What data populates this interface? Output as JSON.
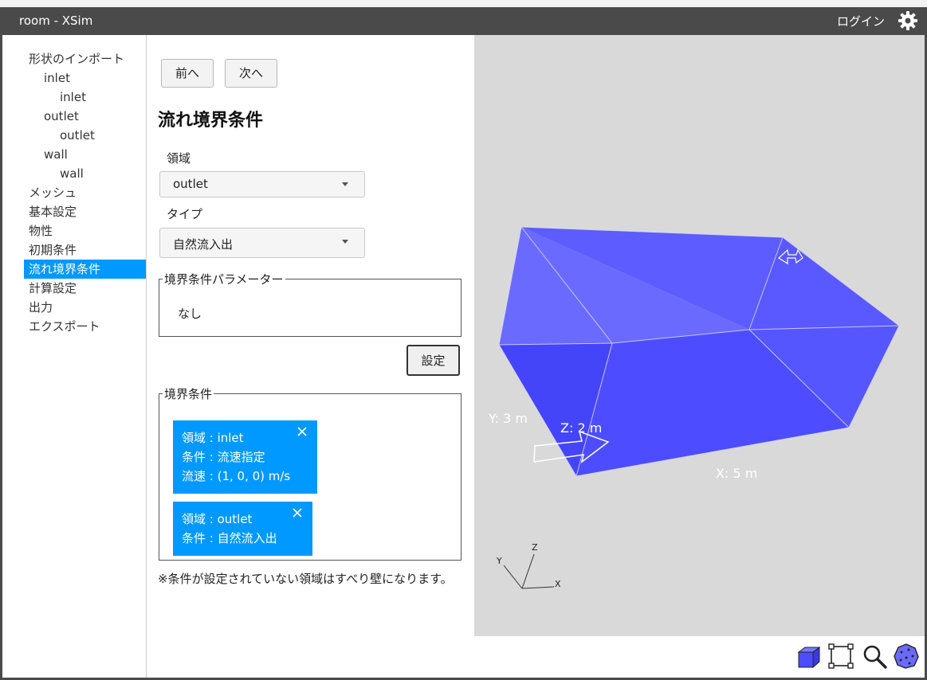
{
  "app": {
    "title": "room - XSim",
    "login_label": "ログイン"
  },
  "sidebar": {
    "items": [
      {
        "label": "形状のインポート"
      },
      {
        "label": "inlet"
      },
      {
        "label": "inlet"
      },
      {
        "label": "outlet"
      },
      {
        "label": "outlet"
      },
      {
        "label": "wall"
      },
      {
        "label": "wall"
      },
      {
        "label": "メッシュ"
      },
      {
        "label": "基本設定"
      },
      {
        "label": "物性"
      },
      {
        "label": "初期条件"
      },
      {
        "label": "流れ境界条件"
      },
      {
        "label": "計算設定"
      },
      {
        "label": "出力"
      },
      {
        "label": "エクスポート"
      }
    ],
    "active_index": 11
  },
  "nav": {
    "prev_label": "前へ",
    "next_label": "次へ"
  },
  "page": {
    "heading": "流れ境界条件",
    "region_label": "領域",
    "region_value": "outlet",
    "type_label": "タイプ",
    "type_value": "自然流入出",
    "params_legend": "境界条件パラメーター",
    "params_value": "なし",
    "set_button": "設定",
    "conditions_legend": "境界条件",
    "note": "※条件が設定されていない領域はすべり壁になります。"
  },
  "conditions": [
    {
      "region": "領域 : inlet",
      "condition": "条件 : 流速指定",
      "velocity": "流速 : (1, 0, 0) m/s"
    },
    {
      "region": "領域 : outlet",
      "condition": "条件 : 自然流入出"
    }
  ],
  "viewport": {
    "dim_x": "X: 5 m",
    "dim_y": "Y: 3 m",
    "dim_z": "Z: 2 m",
    "axis_x": "X",
    "axis_y": "Y",
    "axis_z": "Z",
    "box_color": "#4d4dff",
    "background_color": "#d9d9d9"
  },
  "colors": {
    "accent": "#0099ff",
    "titlebar": "#4a4a4a"
  }
}
